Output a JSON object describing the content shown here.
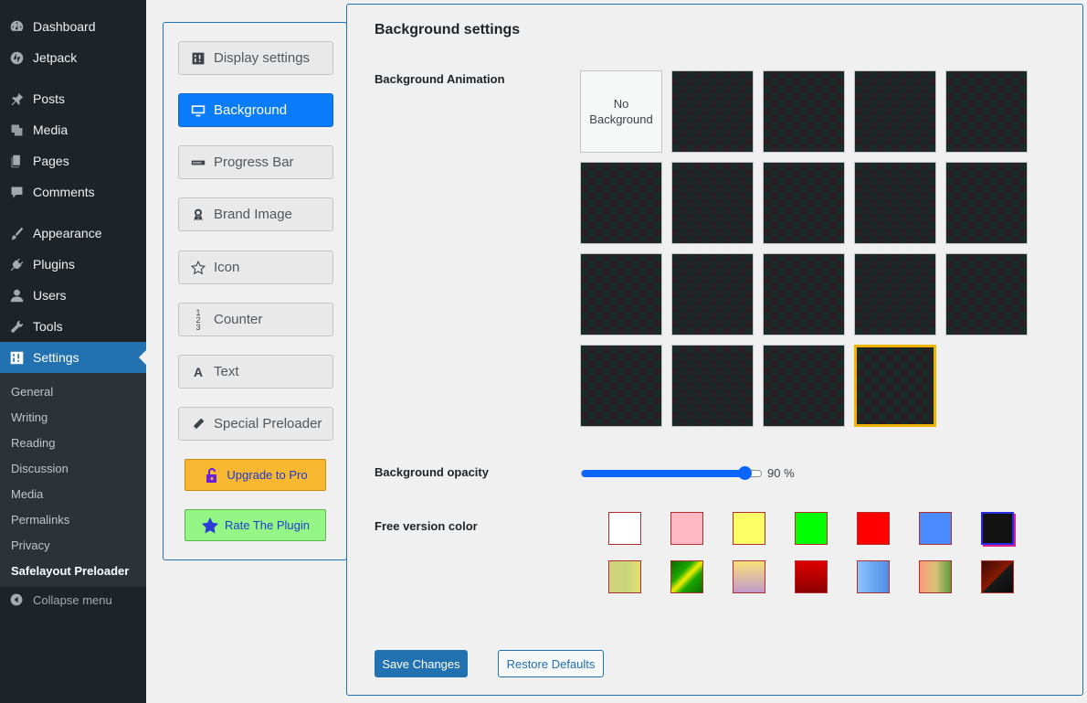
{
  "sidebar": {
    "items": [
      {
        "label": "Dashboard",
        "icon": "dashboard-icon"
      },
      {
        "label": "Jetpack",
        "icon": "jetpack-icon"
      },
      {
        "label": "Posts",
        "icon": "pin-icon"
      },
      {
        "label": "Media",
        "icon": "media-icon"
      },
      {
        "label": "Pages",
        "icon": "pages-icon"
      },
      {
        "label": "Comments",
        "icon": "comment-icon"
      },
      {
        "label": "Appearance",
        "icon": "brush-icon"
      },
      {
        "label": "Plugins",
        "icon": "plug-icon"
      },
      {
        "label": "Users",
        "icon": "user-icon"
      },
      {
        "label": "Tools",
        "icon": "wrench-icon"
      },
      {
        "label": "Settings",
        "icon": "settings-icon"
      }
    ],
    "submenu": [
      "General",
      "Writing",
      "Reading",
      "Discussion",
      "Media",
      "Permalinks",
      "Privacy",
      "Safelayout Preloader"
    ],
    "collapse_label": "Collapse menu"
  },
  "tabs": [
    {
      "label": "Display settings",
      "icon": "sliders-icon"
    },
    {
      "label": "Background",
      "icon": "monitor-icon"
    },
    {
      "label": "Progress Bar",
      "icon": "progress-icon"
    },
    {
      "label": "Brand Image",
      "icon": "award-icon"
    },
    {
      "label": "Icon",
      "icon": "star-icon"
    },
    {
      "label": "Counter",
      "icon": "counter-icon"
    },
    {
      "label": "Text",
      "icon": "text-icon"
    },
    {
      "label": "Special Preloader",
      "icon": "pencil-icon"
    }
  ],
  "active_tab": "Background",
  "promo": {
    "upgrade_label": "Upgrade to Pro",
    "rate_label": "Rate The Plugin"
  },
  "main": {
    "title": "Background settings",
    "animation_label": "Background Animation",
    "no_background_label": "No Background",
    "animation_tile_count": 18,
    "selected_tile_index": 18,
    "opacity_label": "Background opacity",
    "opacity_value": 90,
    "opacity_text": "90 %",
    "color_label": "Free version color",
    "colors_row1": [
      "#ffffff",
      "#ffb9c5",
      "#ffff66",
      "#00ff00",
      "#ff0000",
      "#4a8cff",
      "#121212"
    ],
    "colors_row2": [
      "linear-gradient(90deg,#d2d27a 0%,#c9d67c 50%,#e0e070 100%)",
      "linear-gradient(135deg,#0a6b00 0%,#1ba800 35%,#f5f000 50%,#1ba800 65%,#0a6b00 100%)",
      "linear-gradient(180deg,#f8e07a 0%,#c09bcc 100%)",
      "linear-gradient(180deg,#e00000 0%,#8b0000 100%)",
      "linear-gradient(90deg,#8bc3ff 0%,#4d8fe6 100%)",
      "linear-gradient(90deg,#ff9b7a 0%,#d9c17a 50%,#5a9c3a 100%)",
      "linear-gradient(135deg,#3b0a0a 0%,#8a1a00 50%,#1b1b1b 51%,#0a0a0a 100%)"
    ],
    "save_label": "Save Changes",
    "restore_label": "Restore Defaults"
  }
}
